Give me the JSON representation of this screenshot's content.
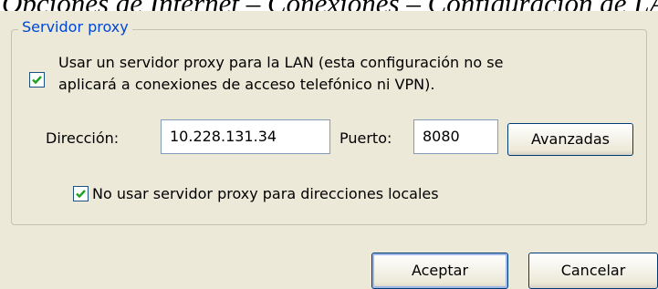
{
  "caption": "Opciones de Internet – Conexiones – Configuración de LAN",
  "proxy_group": {
    "title": "Servidor proxy",
    "use_proxy": {
      "checked": true,
      "line1": "Usar un servidor proxy para la LAN (esta configuración no se",
      "line2": "aplicará a conexiones de acceso telefónico ni VPN)."
    },
    "address_label": "Dirección:",
    "address_value": "10.228.131.34",
    "port_label": "Puerto:",
    "port_value": "8080",
    "advanced_button": "Avanzadas",
    "bypass_local": {
      "checked": true,
      "label": "No usar servidor proxy para direcciones locales"
    }
  },
  "footer": {
    "ok_button": "Aceptar",
    "cancel_button": "Cancelar"
  },
  "colors": {
    "dialog_bg": "#ece9d8",
    "legend_text": "#0046d5",
    "checkmark": "#21a121",
    "button_border": "#003c74"
  }
}
